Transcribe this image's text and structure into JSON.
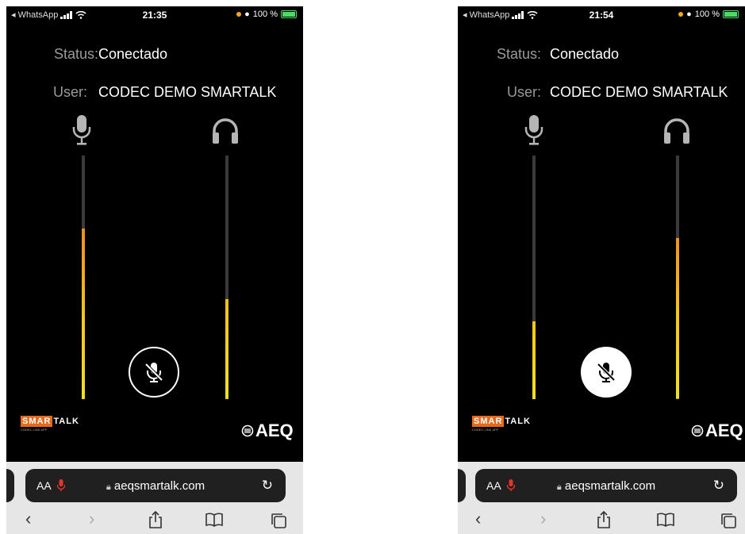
{
  "screens": [
    {
      "statusbar": {
        "back_app": "◂ WhatsApp",
        "time": "21:35",
        "battery": "100 %"
      },
      "status_label": "Status:",
      "status_value": "Conectado",
      "user_label": "User:",
      "user_value": "CODEC DEMO SMARTALK",
      "mic_level": 0.7,
      "headphone_level": 0.41,
      "mute_state": "outline",
      "brand_left": {
        "smar": "SMAR",
        "talk": "TALK",
        "tagline": "CODEC LINK APP"
      },
      "brand_right": "AEQ",
      "browser": {
        "text_size": "AA",
        "url": "aeqsmartalk.com"
      }
    },
    {
      "statusbar": {
        "back_app": "◂ WhatsApp",
        "time": "21:54",
        "battery": "100 %"
      },
      "status_label": "Status:",
      "status_value": "Conectado",
      "user_label": "User:",
      "user_value": "CODEC DEMO SMARTALK",
      "mic_level": 0.32,
      "headphone_level": 0.66,
      "mute_state": "filled",
      "brand_left": {
        "smar": "SMAR",
        "talk": "TALK",
        "tagline": "CODEC LINK APP"
      },
      "brand_right": "AEQ",
      "browser": {
        "text_size": "AA",
        "url": "aeqsmartalk.com"
      }
    }
  ],
  "colors": {
    "meter_top": "#ef5a26",
    "meter_bottom": "#f0e020",
    "meter_track": "#3a3a3a",
    "brand_orange": "#e8691c"
  },
  "icons": [
    "microphone-icon",
    "headphones-icon",
    "mic-muted-icon",
    "lock-icon",
    "reload-icon",
    "back-icon",
    "forward-icon",
    "share-icon",
    "bookmarks-icon",
    "tabs-icon"
  ]
}
